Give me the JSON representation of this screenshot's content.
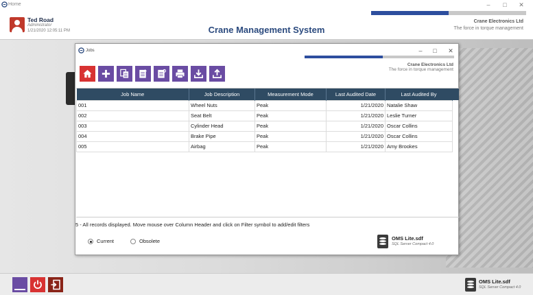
{
  "window": {
    "title": "Home"
  },
  "user": {
    "name": "Ted Road",
    "role": "Administrator",
    "datetime": "1/21/2020 12:05:11 PM"
  },
  "app": {
    "title": "Crane Management System"
  },
  "company": {
    "name": "Crane Electronics Ltd",
    "tagline": "The force in torque management"
  },
  "dialog": {
    "title": "Jobs",
    "company": "Crane Electronics Ltd",
    "tagline": "The force in torque management",
    "toolbar": [
      "home-icon",
      "add-icon",
      "copy-icon",
      "edit-icon",
      "view-icon",
      "print-icon",
      "import-icon",
      "export-icon"
    ],
    "table": {
      "columns": [
        "Job Name",
        "Job Description",
        "Measurement Mode",
        "Last Audited Date",
        "Last Audited By"
      ],
      "rows": [
        [
          "001",
          "Wheel Nuts",
          "Peak",
          "1/21/2020",
          "Natalie Shaw"
        ],
        [
          "002",
          "Seat Belt",
          "Peak",
          "1/21/2020",
          "Leslie Turner"
        ],
        [
          "003",
          "Cylinder Head",
          "Peak",
          "1/21/2020",
          "Oscar Collins"
        ],
        [
          "004",
          "Brake Pipe",
          "Peak",
          "1/21/2020",
          "Oscar Collins"
        ],
        [
          "005",
          "Airbag",
          "Peak",
          "1/21/2020",
          "Amy Brookes"
        ]
      ]
    },
    "status": "5 - All records displayed. Move mouse over Column Header and click on Filter symbol to add/edit filters",
    "radios": [
      {
        "label": "Current",
        "selected": true
      },
      {
        "label": "Obsolete",
        "selected": false
      }
    ],
    "db": {
      "name": "OMS Lite.sdf",
      "engine": "SQL Server Compact 4.0"
    }
  },
  "footer": {
    "db": {
      "name": "OMS Lite.sdf",
      "engine": "SQL Server Compact 4.0"
    }
  },
  "colors": {
    "accent_purple": "#6a4ca3",
    "accent_red": "#d83232",
    "header_blue": "#2f4b63",
    "title_blue": "#2b4a7e"
  }
}
